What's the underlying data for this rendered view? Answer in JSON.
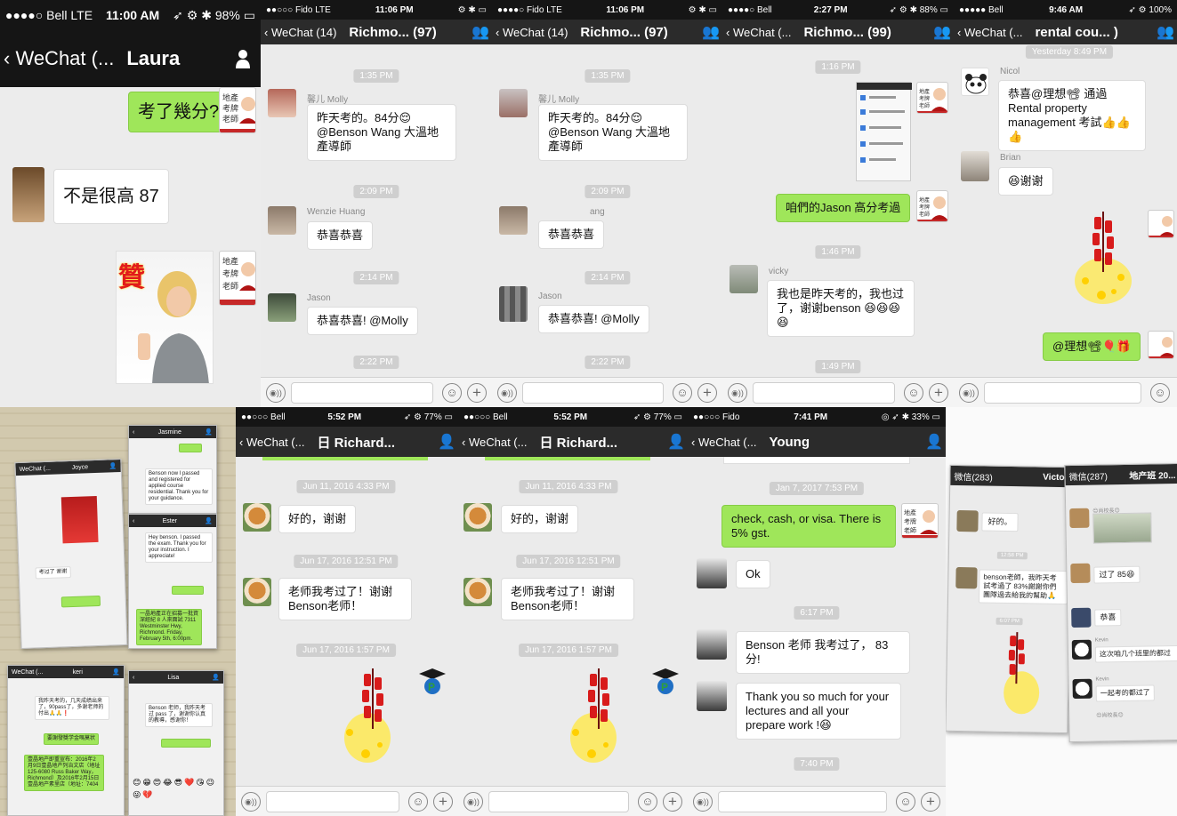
{
  "panels": {
    "p1": {
      "status_carrier": "●●●●○ Bell  LTE",
      "status_time": "11:00 AM",
      "status_battery": "98%",
      "back": "WeChat (...",
      "title": "Laura",
      "msg_me": "考了幾分?",
      "msg_other": "不是很高 87",
      "zan_char": "贊"
    },
    "p2": {
      "status_carrier": "●●○○○ Fido  LTE",
      "status_time": "11:06 PM",
      "back": "WeChat (14)",
      "title": "Richmo... (97)",
      "ts1": "1:35 PM",
      "sender1": "馨儿 Molly",
      "msg1": "昨天考的。84分😌 @Benson Wang 大溫地產導師",
      "ts2": "2:09 PM",
      "sender2": "Wenzie Huang",
      "msg2": "恭喜恭喜",
      "ts3": "2:14 PM",
      "sender3": "Jason",
      "msg3": "恭喜恭喜! @Molly",
      "ts4": "2:22 PM"
    },
    "p3": {
      "status_carrier": "●●●●○ Fido  LTE",
      "status_time": "11:06 PM",
      "back": "WeChat (14)",
      "title": "Richmo... (97)",
      "ts1": "1:35 PM",
      "sender1": "馨儿 Molly",
      "msg1": "昨天考的。84分😌 @Benson Wang 大溫地產導師",
      "ts2": "2:09 PM",
      "sender2": "ang",
      "msg2": "恭喜恭喜",
      "ts3": "2:14 PM",
      "sender3": "Jason",
      "msg3": "恭喜恭喜! @Molly",
      "ts4": "2:22 PM"
    },
    "p4": {
      "status_carrier": "●●●●○ Bell",
      "status_time": "2:27 PM",
      "status_battery": "88%",
      "back": "WeChat (...",
      "title": "Richmo... (99)",
      "ts1": "1:16 PM",
      "msg_me": "咱們的Jason 高分考過",
      "ts2": "1:46 PM",
      "sender1": "vicky",
      "msg1": "我也是昨天考的，我也过了，谢谢benson 😆😆😆😆",
      "ts3": "1:49 PM"
    },
    "p5": {
      "status_carrier": "●●●●● Bell",
      "status_time": "9:46 AM",
      "status_battery": "100%",
      "back": "WeChat (...",
      "title": "rental cou... ) ",
      "ts1": "Yesterday 8:49 PM",
      "sender1": "Nicol",
      "msg1": "恭喜@理想📽 通過Rental property management 考試👍👍👍",
      "sender2": "Brian",
      "msg2": "😆谢谢",
      "msg_me": "@理想📽🎈🎁"
    },
    "p7": {
      "status_carrier": "●●○○○ Bell",
      "status_time": "5:52 PM",
      "status_battery": "77%",
      "back": "WeChat (...",
      "title": "日  Richard...",
      "ts1": "Jun 11, 2016 4:33 PM",
      "msg1": "好的，谢谢",
      "ts2": "Jun 17, 2016 12:51 PM",
      "msg2": "老师我考过了！谢谢Benson老师！",
      "ts3": "Jun 17, 2016 1:57 PM"
    },
    "p8": {
      "status_carrier": "●●○○○ Bell",
      "status_time": "5:52 PM",
      "status_battery": "77%",
      "back": "WeChat (...",
      "title": "日  Richard...",
      "ts1": "Jun 11, 2016 4:33 PM",
      "msg1": "好的，谢谢",
      "ts2": "Jun 17, 2016 12:51 PM",
      "msg2": "老师我考过了！谢谢Benson老师！",
      "ts3": "Jun 17, 2016 1:57 PM"
    },
    "p9": {
      "status_carrier": "●●○○○ Fido",
      "status_time": "7:41 PM",
      "status_battery": "33%",
      "back": "WeChat (...",
      "title": "Young",
      "ts1": "Jan 7, 2017 7:53 PM",
      "msg_me": "check, cash, or visa.  There is 5% gst.",
      "msg1": "Ok",
      "ts2": "6:17 PM",
      "msg2": "Benson 老师 我考过了， 83分!",
      "msg3": "Thank you so much for your lectures and all your prepare work !😆",
      "ts3": "7:40 PM"
    },
    "p6": {
      "a_back": "WeChat (...",
      "a_title": "Joyce",
      "a_msg": "考过了 谢谢",
      "b_title": "Jasmine",
      "b_msg": "Benson now I passed and registered for applied course residential. Thank you for your guidance.",
      "c_title": "Ester",
      "c_msg": "Hey benson. I passed the exam. Thank you for your instruction. I appreciate!",
      "c_me": "一晶地產正在招募一批資深經紀 8 人來面試 7311 Westminster Hwy, Richmond. Friday, February 5th, 6:00pm.",
      "d_back": "WeChat (...",
      "d_title": "keri",
      "d_msg": "我昨天考的，几天成绩出来了，90pass了，多谢老师的付出🙏🙏❗",
      "d_me1": "要謝發獎学金嗎莫状",
      "d_me2": "壹晶地产即重宣布：2016年2月9日壹晶地产列治文店（地址125-6080 Russ Baker Way，Richmond）及2016年2月15日壹晶地产素里店（地址：7404",
      "e_title": "Lisa",
      "e_msg": "Benson 老师，我昨天考过 pass 了，谢谢你认真的教導，感谢你！"
    },
    "p10": {
      "a_back": "微信(283)",
      "a_title": "Victor",
      "a_msg1": "好的。",
      "a_ts": "12:58 PM",
      "a_msg2": "benson老師，我昨天考試考過了 83%謝謝你們團隊過去給我的幫助🙏",
      "a_ts2": "6:07 PM",
      "b_back": "微信(287)",
      "b_title": "地产班 20...",
      "b_name1": "😊尚校長😊",
      "b_msg1": "过了 85😆",
      "b_msg2": "恭喜",
      "b_name2": "Kevin",
      "b_msg3": "这次咱几个班里的都过",
      "b_name3": "Kevin",
      "b_msg4": "一起考的都过了",
      "b_name4": "😊尚校長😊"
    }
  },
  "colors": {
    "wechat_green": "#9fe65a",
    "navbar": "#2b2b2b",
    "chat_bg": "#ebebeb",
    "statusbar": "#151515"
  }
}
